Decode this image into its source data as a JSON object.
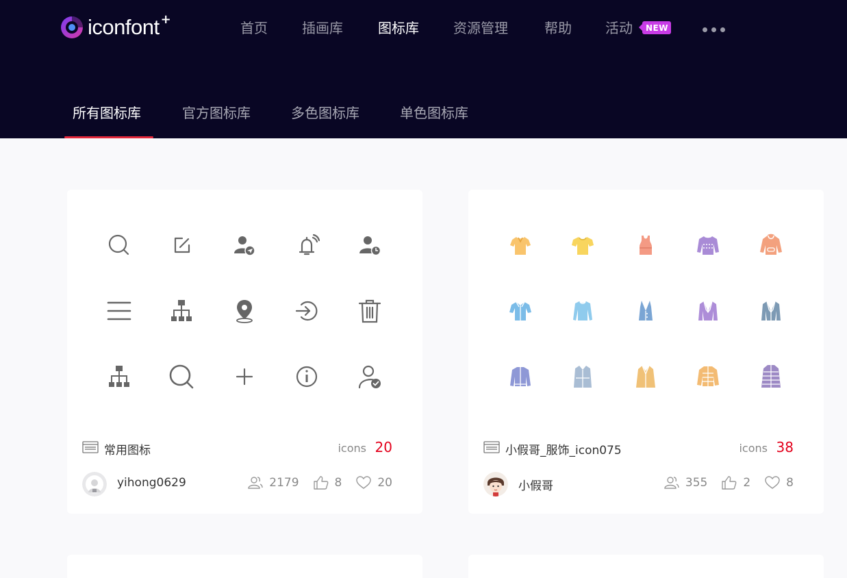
{
  "logo": {
    "text": "iconfont",
    "plus": "+"
  },
  "nav": {
    "items": [
      "首页",
      "插画库",
      "图标库",
      "资源管理",
      "帮助",
      "活动"
    ],
    "active_index": 2,
    "new_badge": "NEW"
  },
  "subnav": {
    "items": [
      "所有图标库",
      "官方图标库",
      "多色图标库",
      "单色图标库"
    ],
    "active_index": 0
  },
  "cards": [
    {
      "title": "常用图标",
      "icons_label": "icons",
      "icons_count": "20",
      "author": "yihong0629",
      "avatar": "default-avatar",
      "stats": {
        "users": "2179",
        "likes": "8",
        "favorites": "20"
      },
      "icons": [
        "search-icon",
        "edit-icon",
        "user-send-icon",
        "bell-ringing-icon",
        "user-clock-icon",
        "menu-icon",
        "org-chart-icon",
        "location-pin-icon",
        "login-icon",
        "trash-icon",
        "org-chart-icon",
        "search-icon",
        "plus-icon",
        "info-icon",
        "user-check-icon"
      ],
      "icon_color": "#666666"
    },
    {
      "title": "小假哥_服饰_icon075",
      "icons_label": "icons",
      "icons_count": "38",
      "author": "小假哥",
      "avatar": "cartoon-avatar",
      "stats": {
        "users": "355",
        "likes": "2",
        "favorites": "8"
      },
      "icons": [
        "polo-shirt-icon",
        "tshirt-icon",
        "tank-top-icon",
        "sweater-icon",
        "hoodie-icon",
        "shirt-icon",
        "long-sleeve-icon",
        "vest-icon",
        "blazer-icon",
        "suit-jacket-icon",
        "zip-jacket-icon",
        "trench-coat-icon",
        "coat-icon",
        "down-jacket-icon",
        "puffer-coat-icon"
      ],
      "icon_colors": [
        "#f9c46c",
        "#f8d55e",
        "#f49a84",
        "#a98bd6",
        "#f3a17e",
        "#7bbce8",
        "#8fcbed",
        "#7aa5d4",
        "#ad8dd8",
        "#7d9ab4",
        "#8e98d6",
        "#a9bdd4",
        "#f0c177",
        "#f3bb73",
        "#9d8ac5"
      ]
    }
  ]
}
